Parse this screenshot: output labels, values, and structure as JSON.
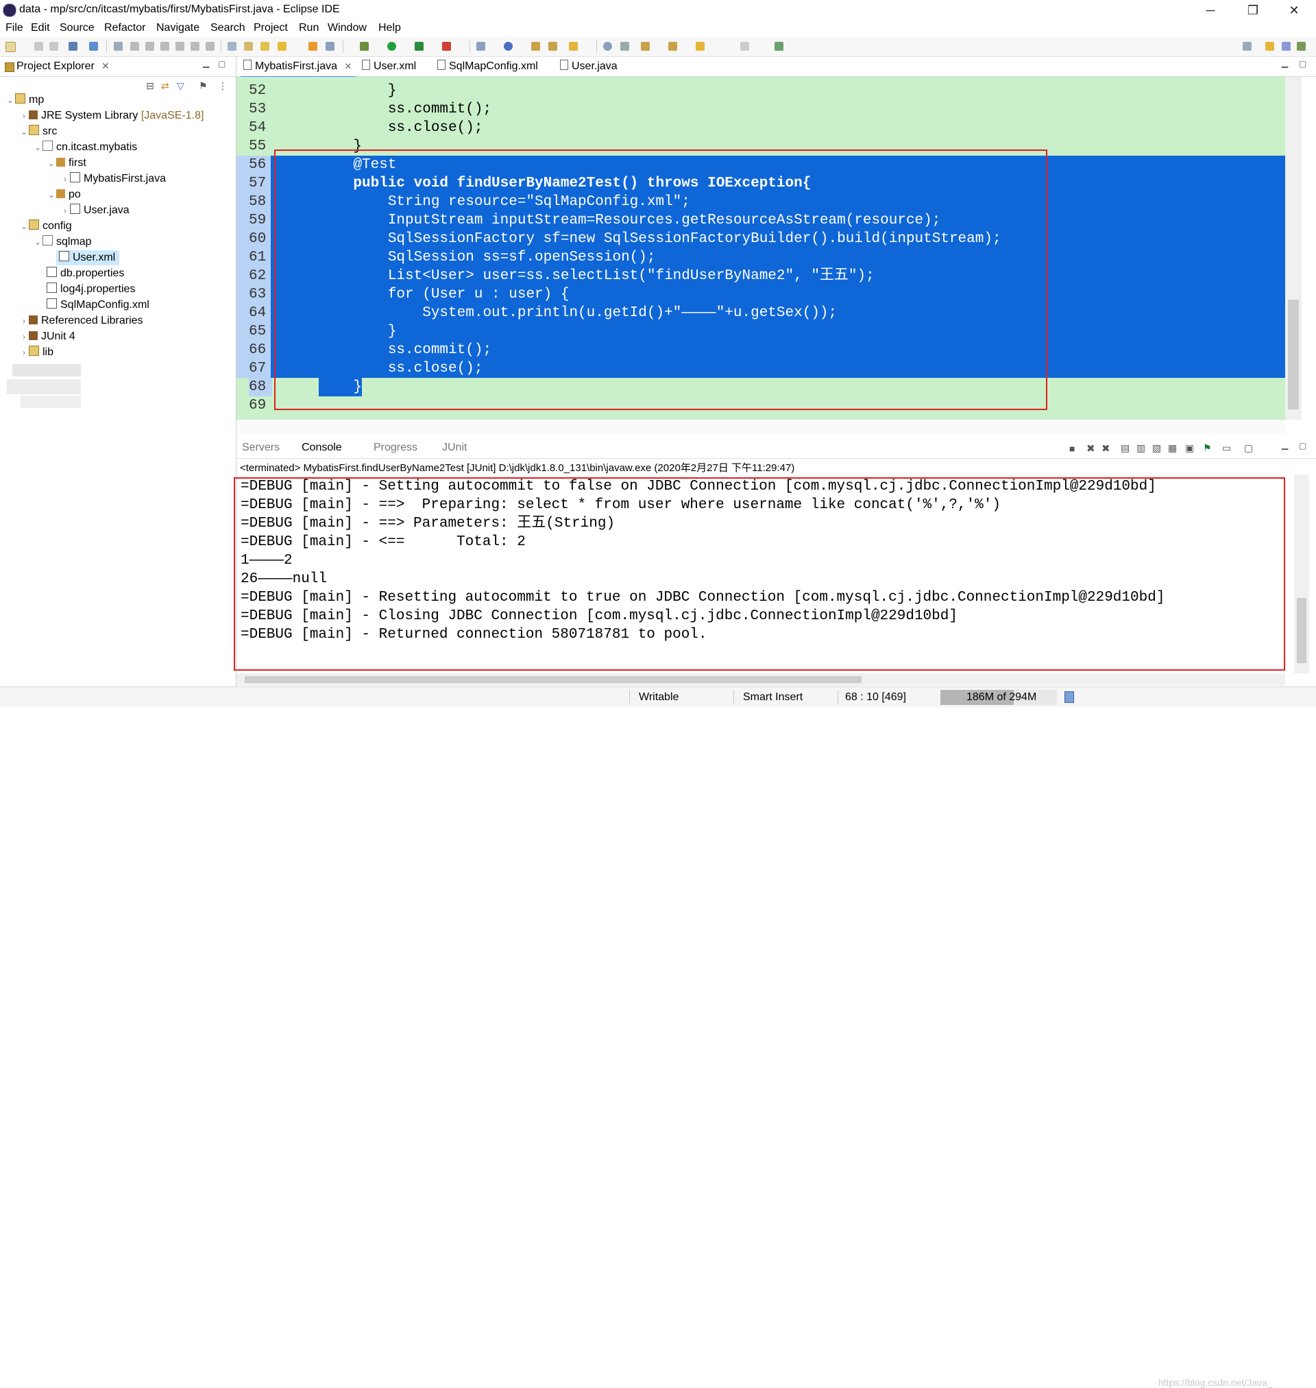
{
  "window": {
    "title": "data - mp/src/cn/itcast/mybatis/first/MybatisFirst.java - Eclipse IDE",
    "minimize": "─",
    "maximize": "❐",
    "close": "✕"
  },
  "menu": [
    "File",
    "Edit",
    "Source",
    "Refactor",
    "Navigate",
    "Search",
    "Project",
    "Run",
    "Window",
    "Help"
  ],
  "project_explorer": {
    "tab_label": "Project Explorer",
    "tree": [
      {
        "label": "mp",
        "arrow": "⌄"
      },
      {
        "label": "JRE System Library",
        "version": "[JavaSE-1.8]",
        "arrow": "›"
      },
      {
        "label": "src",
        "arrow": "⌄"
      },
      {
        "label": "cn.itcast.mybatis",
        "arrow": "⌄"
      },
      {
        "label": "first",
        "arrow": "⌄"
      },
      {
        "label": "MybatisFirst.java",
        "arrow": "›"
      },
      {
        "label": "po",
        "arrow": "⌄"
      },
      {
        "label": "User.java",
        "arrow": "›"
      },
      {
        "label": "config",
        "arrow": "⌄"
      },
      {
        "label": "sqlmap",
        "arrow": "⌄"
      },
      {
        "label": "User.xml",
        "arrow": ""
      },
      {
        "label": "db.properties",
        "arrow": ""
      },
      {
        "label": "log4j.properties",
        "arrow": ""
      },
      {
        "label": "SqlMapConfig.xml",
        "arrow": ""
      },
      {
        "label": "Referenced Libraries",
        "arrow": "›"
      },
      {
        "label": "JUnit 4",
        "arrow": "›"
      },
      {
        "label": "lib",
        "arrow": "›"
      }
    ]
  },
  "editor": {
    "tabs": [
      "MybatisFirst.java",
      "User.xml",
      "SqlMapConfig.xml",
      "User.java"
    ],
    "lines": [
      {
        "n": "52",
        "text": "        }"
      },
      {
        "n": "53",
        "text": "        ss.commit();"
      },
      {
        "n": "54",
        "text": "        ss.close();"
      },
      {
        "n": "55",
        "text": "    }"
      },
      {
        "n": "56",
        "text": "    @Test"
      },
      {
        "n": "57",
        "text": "    public void findUserByName2Test() throws IOException{"
      },
      {
        "n": "58",
        "text": "        String resource=\"SqlMapConfig.xml\";"
      },
      {
        "n": "59",
        "text": "        InputStream inputStream=Resources.getResourceAsStream(resource);"
      },
      {
        "n": "60",
        "text": "        SqlSessionFactory sf=new SqlSessionFactoryBuilder().build(inputStream);"
      },
      {
        "n": "61",
        "text": "        SqlSession ss=sf.openSession();"
      },
      {
        "n": "62",
        "text": "        List<User> user=ss.selectList(\"findUserByName2\", \"王五\");"
      },
      {
        "n": "63",
        "text": "        for (User u : user) {"
      },
      {
        "n": "64",
        "text": "            System.out.println(u.getId()+\"————\"+u.getSex());"
      },
      {
        "n": "65",
        "text": "        }"
      },
      {
        "n": "66",
        "text": "        ss.commit();"
      },
      {
        "n": "67",
        "text": "        ss.close();"
      },
      {
        "n": "68",
        "text": "    }"
      },
      {
        "n": "69",
        "text": ""
      }
    ]
  },
  "console": {
    "tabs": [
      "Servers",
      "Console",
      "Progress",
      "JUnit"
    ],
    "terminated": "<terminated> MybatisFirst.findUserByName2Test [JUnit] D:\\jdk\\jdk1.8.0_131\\bin\\javaw.exe (2020年2月27日 下午11:29:47)",
    "lines": [
      "=DEBUG [main] - Setting autocommit to false on JDBC Connection [com.mysql.cj.jdbc.ConnectionImpl@229d10bd]",
      "=DEBUG [main] - ==>  Preparing: select * from user where username like concat('%',?,'%')",
      "=DEBUG [main] - ==> Parameters: 王五(String)",
      "=DEBUG [main] - <==      Total: 2",
      "1————2",
      "26————null",
      "=DEBUG [main] - Resetting autocommit to true on JDBC Connection [com.mysql.cj.jdbc.ConnectionImpl@229d10bd]",
      "=DEBUG [main] - Closing JDBC Connection [com.mysql.cj.jdbc.ConnectionImpl@229d10bd]",
      "=DEBUG [main] - Returned connection 580718781 to pool."
    ]
  },
  "status": {
    "writable": "Writable",
    "insert_mode": "Smart Insert",
    "position": "68 : 10 [469]",
    "heap": "186M of 294M",
    "heap_used_fraction": 0.63
  },
  "watermark": "https://blog.csdn.net/Java_"
}
